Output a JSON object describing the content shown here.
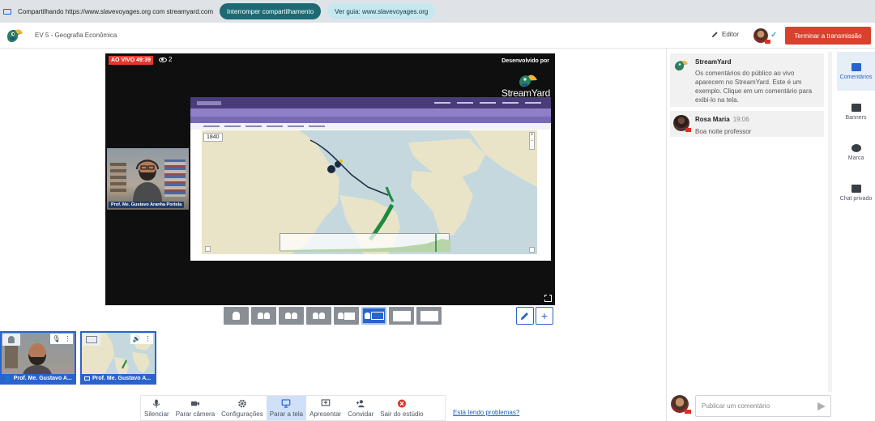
{
  "share_bar": {
    "sharing_text": "Compartilhando https://www.slavevoyages.org com streamyard.com",
    "stop_button": "Interromper compartilhamento",
    "view_tab_button": "Ver guia: www.slavevoyages.org"
  },
  "header": {
    "title": "EV 5 - Geografia Econômica",
    "editor_label": "Editor",
    "end_button": "Terminar a transmissão"
  },
  "stage": {
    "live_label": "AO VIVO 49:39",
    "viewer_count": "2",
    "developed_by": "Desenvolvido por",
    "brand": "StreamYard",
    "presenter_name": "Prof. Me. Gustavo Aranha Portela",
    "map_year": "1840"
  },
  "thumbnails": [
    {
      "label": "Prof. Me. Gustavo A...",
      "type": "camera"
    },
    {
      "label": "Prof. Me. Gustavo A...",
      "type": "screen"
    }
  ],
  "toolbar": {
    "items": [
      {
        "label": "Silenciar",
        "icon": "mic-icon"
      },
      {
        "label": "Parar câmera",
        "icon": "camera-icon"
      },
      {
        "label": "Configurações",
        "icon": "gear-icon"
      },
      {
        "label": "Parar a tela",
        "icon": "monitor-icon"
      },
      {
        "label": "Apresentar",
        "icon": "present-icon"
      },
      {
        "label": "Convidar",
        "icon": "add-person-icon"
      },
      {
        "label": "Sair do estúdio",
        "icon": "exit-icon"
      }
    ],
    "problems_link": "Está tendo problemas?"
  },
  "comments": [
    {
      "name": "StreamYard",
      "time": "",
      "text": "Os comentários do público ao vivo aparecem no StreamYard. Este é um exemplo. Clique em um comentário para exibi-lo na tela."
    },
    {
      "name": "Rosa Maria",
      "time": "19:06",
      "text": "Boa noite professor"
    }
  ],
  "comment_input": {
    "placeholder": "Publicar um comentário"
  },
  "rail": [
    {
      "label": "Comentários"
    },
    {
      "label": "Banners"
    },
    {
      "label": "Marca"
    },
    {
      "label": "Chat privado"
    }
  ],
  "colors": {
    "accent": "#2a63cc",
    "live": "#e13a2e",
    "end_button": "#d9412c",
    "share_stop": "#1c6a73"
  }
}
